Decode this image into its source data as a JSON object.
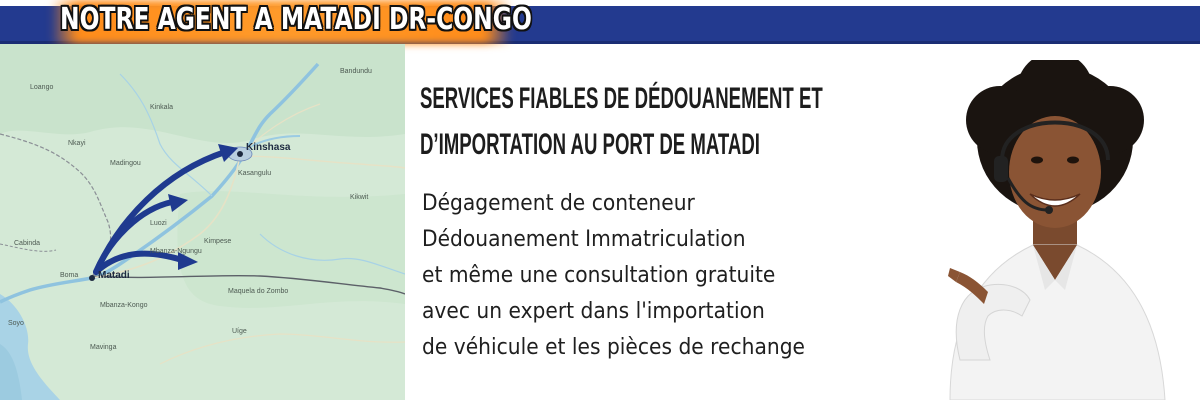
{
  "header": {
    "title": "NOTRE AGENT A MATADI DR-CONGO",
    "band_color": "#233a8f",
    "glow_color": "#ff8c1a"
  },
  "map": {
    "cities": {
      "kinshasa": "Kinshasa",
      "matadi": "Matadi"
    },
    "labels": [
      "Loango",
      "Kinkala",
      "Mbanza-Ngungu",
      "Kasangulu",
      "Boma",
      "Mbanza-Kongo",
      "Luozi",
      "Kimpese",
      "Kikwit",
      "Bandundu",
      "Maquela do Zombo",
      "Uíge",
      "Soyo",
      "Mavinga",
      "Nkayi",
      "Madingou",
      "Cabinda"
    ],
    "arrow_color": "#1f3a8f"
  },
  "content": {
    "heading_lines": [
      "SERVICES FIABLES DE DÉDOUANEMENT ET",
      "D’IMPORTATION AU PORT DE MATADI"
    ],
    "service_lines": [
      "Dégagement de conteneur",
      "Dédouanement Immatriculation",
      "et même une consultation gratuite",
      " avec un expert dans l'importation",
      " de véhicule et les pièces de rechange"
    ]
  }
}
